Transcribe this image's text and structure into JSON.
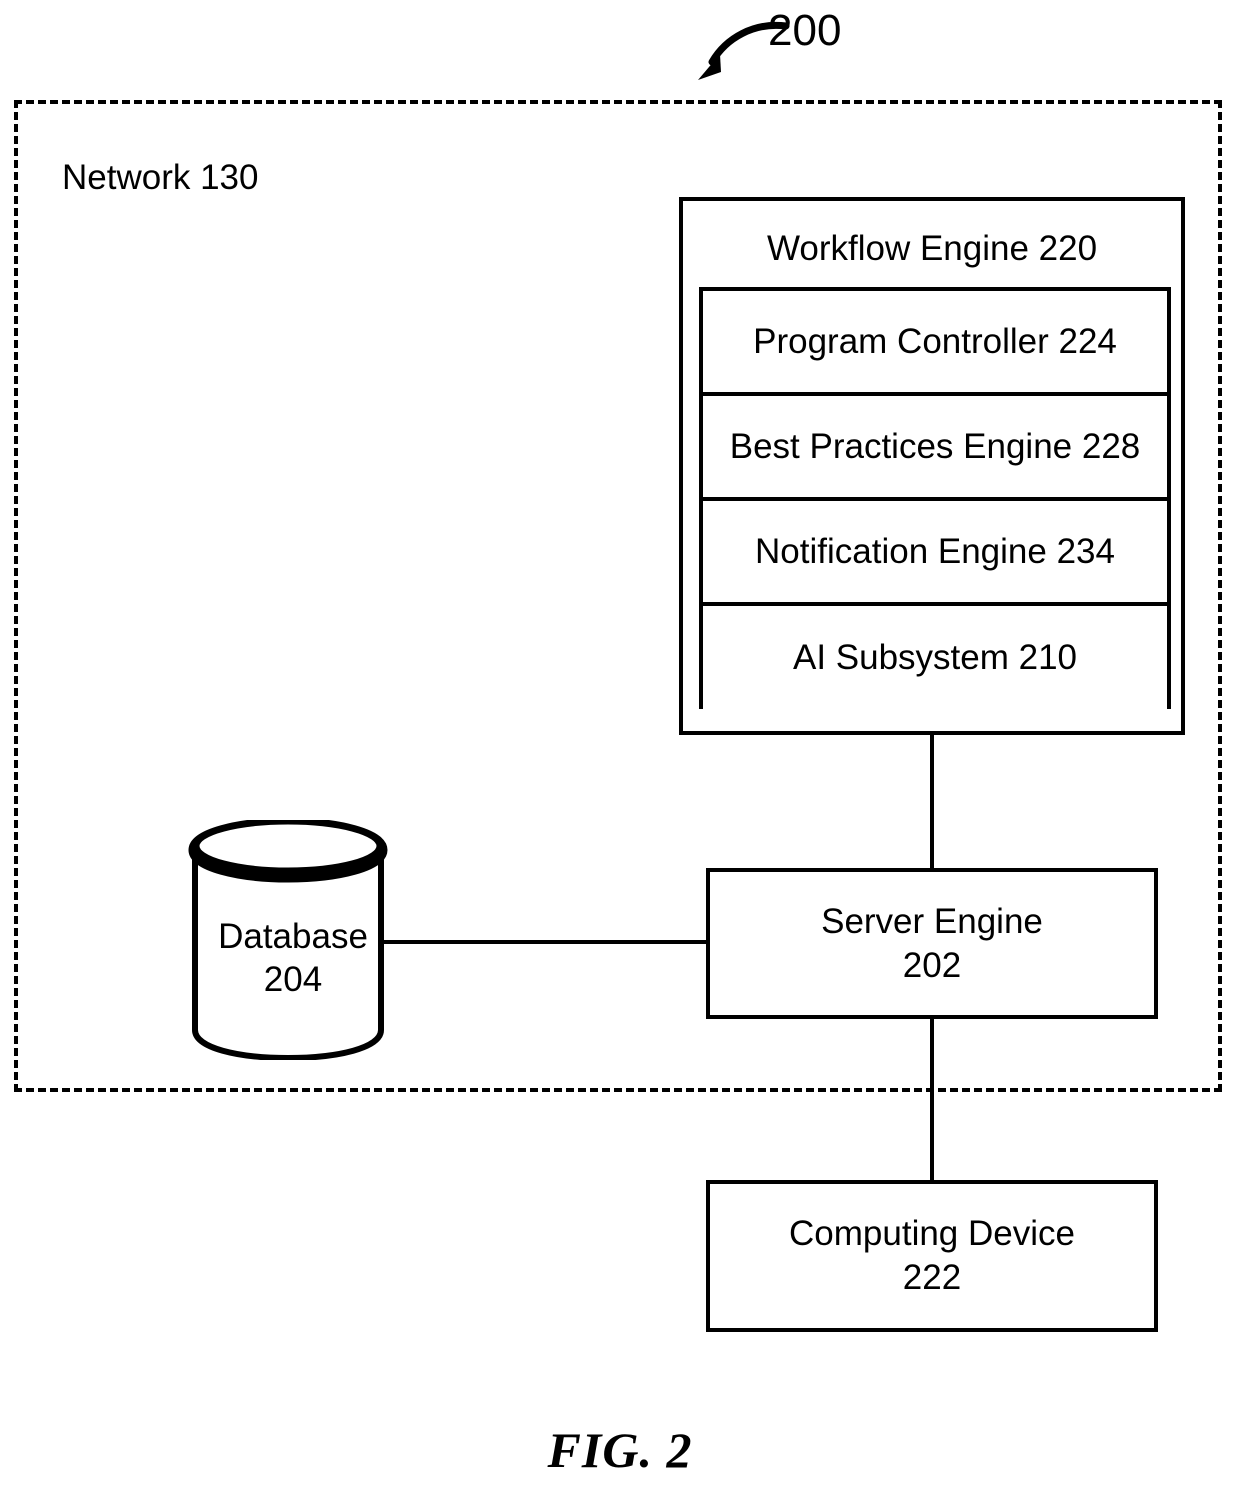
{
  "figure": {
    "caption": "FIG. 2",
    "reference_numeral": "200"
  },
  "network": {
    "label": "Network 130",
    "boundary_style": "dashed"
  },
  "workflow_engine": {
    "title": "Workflow Engine 220",
    "components": [
      {
        "label": "Program Controller 224"
      },
      {
        "label": "Best Practices Engine 228"
      },
      {
        "label": "Notification Engine 234"
      },
      {
        "label": "AI Subsystem 210"
      }
    ]
  },
  "database": {
    "name": "Database",
    "numeral": "204"
  },
  "server_engine": {
    "name": "Server Engine",
    "numeral": "202"
  },
  "computing_device": {
    "name": "Computing Device",
    "numeral": "222"
  },
  "colors": {
    "stroke": "#000000",
    "background": "#ffffff"
  }
}
